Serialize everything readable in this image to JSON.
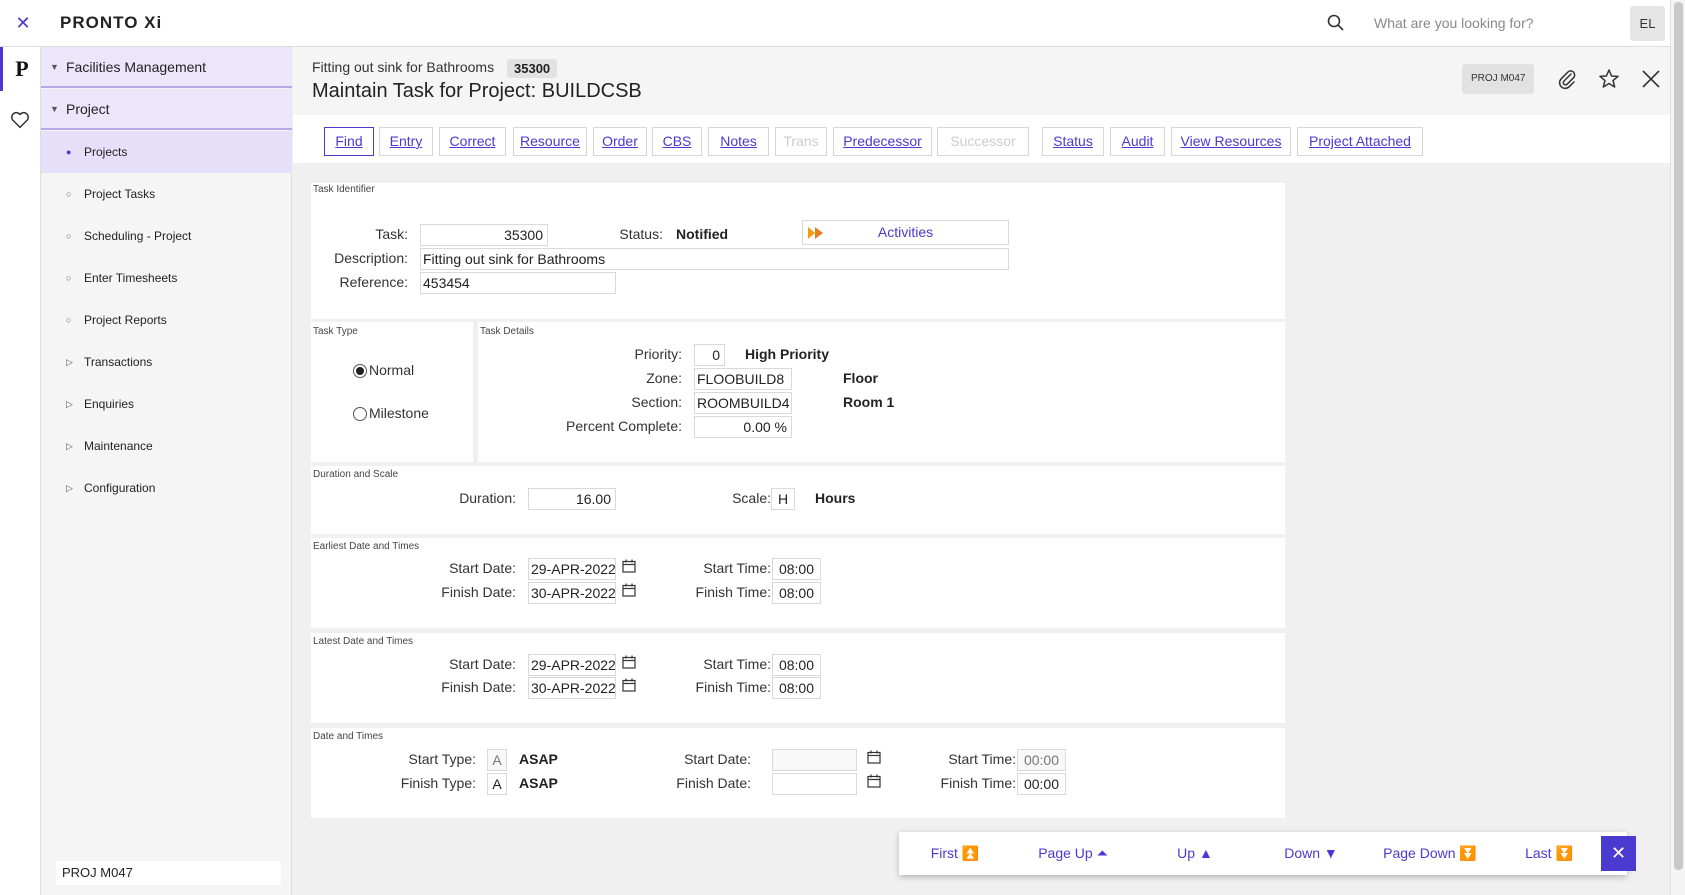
{
  "app": {
    "logo": "PRONTO Xi",
    "close_glyph": "✕",
    "rail_logo": "P"
  },
  "search": {
    "placeholder": "What are you looking for?",
    "value": ""
  },
  "user": {
    "initials": "EL"
  },
  "sidebar": {
    "groups": [
      {
        "label": "Facilities Management"
      },
      {
        "label": "Project"
      }
    ],
    "items": [
      {
        "label": "Projects",
        "marker": "●"
      },
      {
        "label": "Project Tasks",
        "marker": "○"
      },
      {
        "label": "Scheduling - Project",
        "marker": "○"
      },
      {
        "label": "Enter Timesheets",
        "marker": "○"
      },
      {
        "label": "Project Reports",
        "marker": "○"
      },
      {
        "label": "Transactions",
        "marker": "▷"
      },
      {
        "label": "Enquiries",
        "marker": "▷"
      },
      {
        "label": "Maintenance",
        "marker": "▷"
      },
      {
        "label": "Configuration",
        "marker": "▷"
      }
    ],
    "footer": "PROJ M047"
  },
  "header": {
    "subtitle": "Fitting out sink for Bathrooms",
    "badge": "35300",
    "title": "Maintain Task for Project: BUILDCSB",
    "program": "PROJ M047"
  },
  "toolbar": {
    "buttons": [
      {
        "label": "Find"
      },
      {
        "label": "Entry"
      },
      {
        "label": "Correct"
      },
      {
        "label": "Resource"
      },
      {
        "label": "Order"
      },
      {
        "label": "CBS"
      },
      {
        "label": "Notes"
      },
      {
        "label": "Trans"
      },
      {
        "label": "Predecessor"
      },
      {
        "label": "Successor"
      },
      {
        "label": "Status"
      },
      {
        "label": "Audit"
      },
      {
        "label": "View Resources"
      },
      {
        "label": "Project Attached"
      }
    ]
  },
  "task_identifier": {
    "section": "Task Identifier",
    "task_label": "Task:",
    "task": "35300",
    "status_label": "Status:",
    "status": "Notified",
    "activities": "Activities",
    "description_label": "Description:",
    "description": "Fitting out sink for Bathrooms",
    "reference_label": "Reference:",
    "reference": "453454"
  },
  "task_type": {
    "section": "Task Type",
    "options": [
      {
        "label": "Normal",
        "selected": true
      },
      {
        "label": "Milestone",
        "selected": false
      }
    ]
  },
  "task_details": {
    "section": "Task Details",
    "priority_label": "Priority:",
    "priority": "0",
    "priority_desc": "High Priority",
    "zone_label": "Zone:",
    "zone": "FLOOBUILD8",
    "zone_desc": "Floor",
    "section_label": "Section:",
    "section_code": "ROOMBUILD4",
    "section_desc": "Room 1",
    "percent_label": "Percent Complete:",
    "percent": "0.00 %"
  },
  "duration": {
    "section": "Duration and Scale",
    "duration_label": "Duration:",
    "duration": "16.00",
    "scale_label": "Scale:",
    "scale": "H",
    "scale_desc": "Hours"
  },
  "earliest": {
    "section": "Earliest Date and Times",
    "start_date_label": "Start Date:",
    "start_date": "29-APR-2022",
    "finish_date_label": "Finish Date:",
    "finish_date": "30-APR-2022",
    "start_time_label": "Start Time:",
    "start_time": "08:00",
    "finish_time_label": "Finish Time:",
    "finish_time": "08:00"
  },
  "latest": {
    "section": "Latest Date and Times",
    "start_date_label": "Start Date:",
    "start_date": "29-APR-2022",
    "finish_date_label": "Finish Date:",
    "finish_date": "30-APR-2022",
    "start_time_label": "Start Time:",
    "start_time": "08:00",
    "finish_time_label": "Finish Time:",
    "finish_time": "08:00"
  },
  "dates": {
    "section": "Date and Times",
    "start_type_label": "Start Type:",
    "start_type": "A",
    "start_type_desc": "ASAP",
    "finish_type_label": "Finish Type:",
    "finish_type": "A",
    "finish_type_desc": "ASAP",
    "start_date_label": "Start Date:",
    "start_date": "",
    "finish_date_label": "Finish Date:",
    "finish_date": "",
    "start_time_label": "Start Time:",
    "start_time": "00:00",
    "finish_time_label": "Finish Time:",
    "finish_time": "00:00"
  },
  "pager": {
    "first": "First",
    "first_icon": "⏫",
    "page_up": "Page Up",
    "page_up_icon": "⏶",
    "up": "Up",
    "up_icon": "▲",
    "down": "Down",
    "down_icon": "▼",
    "page_down": "Page Down",
    "page_down_icon": "⏬",
    "last": "Last",
    "last_icon": "⏬",
    "close_glyph": "✕"
  },
  "colors": {
    "accent": "#4a3ad0",
    "sidebar_active": "#ece6fb"
  }
}
